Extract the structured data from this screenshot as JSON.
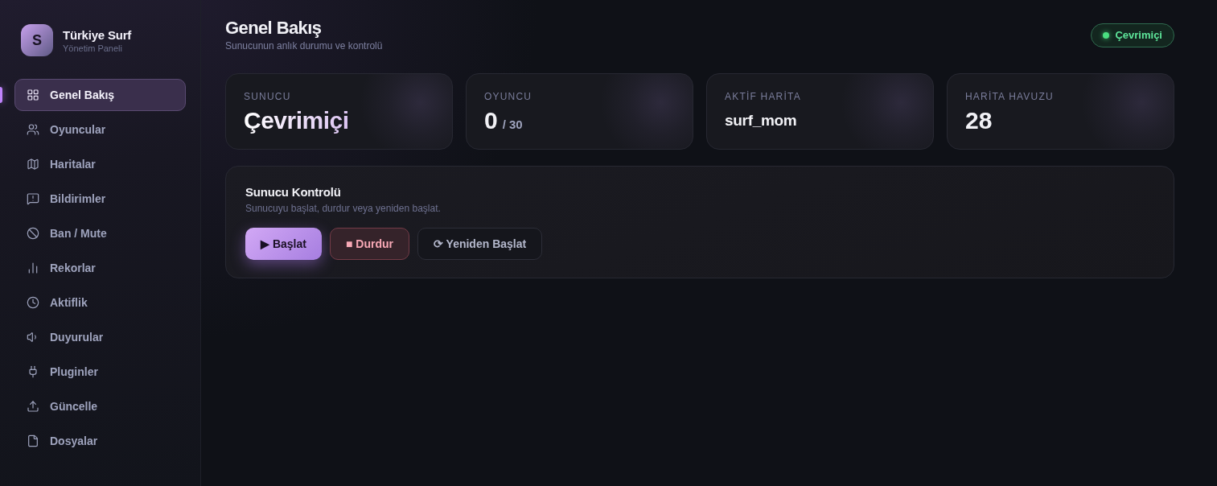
{
  "sidebar": {
    "logo": "S",
    "title": "Türkiye Surf",
    "subtitle": "Yönetim Paneli",
    "items": [
      {
        "label": "Genel Bakış",
        "selected": true
      },
      {
        "label": "Oyuncular",
        "selected": false
      },
      {
        "label": "Haritalar",
        "selected": false
      },
      {
        "label": "Bildirimler",
        "selected": false
      },
      {
        "label": "Ban / Mute",
        "selected": false
      },
      {
        "label": "Rekorlar",
        "selected": false
      },
      {
        "label": "Aktiflik",
        "selected": false
      },
      {
        "label": "Duyurular",
        "selected": false
      },
      {
        "label": "Pluginler",
        "selected": false
      },
      {
        "label": "Güncelle",
        "selected": false
      },
      {
        "label": "Dosyalar",
        "selected": false
      }
    ]
  },
  "header": {
    "title": "Genel Bakış",
    "subtitle": "Sunucunun anlık durumu ve kontrolü",
    "status": {
      "label": "Çevrimiçi",
      "online": true
    }
  },
  "stats": [
    {
      "kind": "status",
      "label": "SUNUCU",
      "value": "Çevrimiçi"
    },
    {
      "kind": "count",
      "label": "OYUNCU",
      "value": "0",
      "max": "/ 30"
    },
    {
      "kind": "text",
      "label": "AKTİF HARİTA",
      "value": "surf_mom"
    },
    {
      "kind": "number",
      "label": "HARİTA HAVUZU",
      "value": "28"
    }
  ],
  "control": {
    "title": "Sunucu Kontrolü",
    "subtitle": "Sunucuyu başlat, durdur veya yeniden başlat.",
    "buttons": [
      {
        "kind": "primary",
        "label": "▶ Başlat"
      },
      {
        "kind": "danger",
        "label": "■ Durdur"
      },
      {
        "kind": "secondary",
        "label": "⟳ Yeniden Başlat"
      }
    ]
  }
}
